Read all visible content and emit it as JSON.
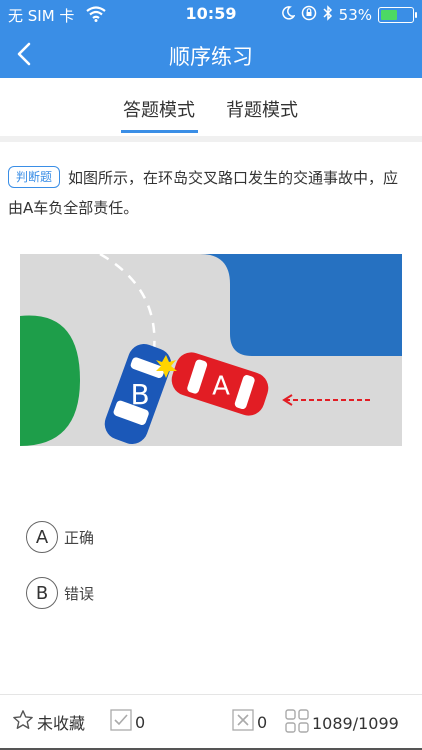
{
  "status_bar": {
    "carrier": "无 SIM 卡",
    "time": "10:59",
    "battery": "53%",
    "battery_level": 0.53
  },
  "nav": {
    "title": "顺序练习"
  },
  "tabs": [
    {
      "label": "答题模式",
      "active": true
    },
    {
      "label": "背题模式",
      "active": false
    }
  ],
  "question": {
    "type_label": "判断题",
    "text": "如图所示，在环岛交叉路口发生的交通事故中，应由A车负全部责任。"
  },
  "scene": {
    "car_a_label": "A",
    "car_b_label": "B",
    "colors": {
      "road": "#d9d9d9",
      "island": "#1e9e4a",
      "water": "#2671c1",
      "car_a": "#e21d24",
      "car_b": "#1b58b8"
    }
  },
  "options": [
    {
      "key": "A",
      "text": "正确"
    },
    {
      "key": "B",
      "text": "错误"
    }
  ],
  "bottom_bar": {
    "favorite_label": "未收藏",
    "correct_count": "0",
    "wrong_count": "0",
    "progress": "1089/1099"
  },
  "colors": {
    "primary": "#3a8ee6"
  },
  "icons": [
    "back-chevron-icon",
    "wifi-icon",
    "moon-icon",
    "lock-rotation-icon",
    "bluetooth-icon",
    "star-icon",
    "check-box-icon",
    "x-box-icon",
    "grid-icon"
  ]
}
